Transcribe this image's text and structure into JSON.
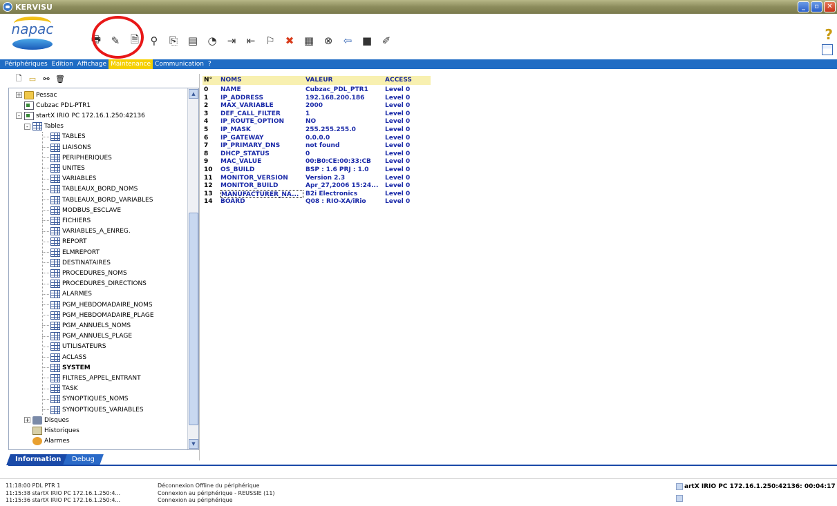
{
  "window": {
    "title": "KERVISU",
    "min_label": "_",
    "max_label": "▫",
    "close_label": "✕"
  },
  "logo": {
    "text": "napac"
  },
  "menu": {
    "items": [
      {
        "label": "Périphériques",
        "active": false
      },
      {
        "label": "Edition",
        "active": false
      },
      {
        "label": "Affichage",
        "active": false
      },
      {
        "label": "Maintenance",
        "active": true
      },
      {
        "label": "Communication",
        "active": false
      },
      {
        "label": "?",
        "active": false
      }
    ]
  },
  "toolbar": {
    "icons": [
      "print-icon",
      "edit-icon",
      "document-icon",
      "binoculars-icon",
      "copy-icon",
      "paste-icon",
      "disk-icon",
      "export-icon",
      "import-icon",
      "probe-icon",
      "cancel-icon",
      "properties-icon",
      "stop-icon",
      "back-icon",
      "black-panel-icon",
      "brush-icon"
    ],
    "help_label": "?"
  },
  "tree": {
    "rows": [
      {
        "label": "Pessac",
        "level": 1,
        "icon": "folder",
        "expander": "+"
      },
      {
        "label": "Cubzac PDL-PTR1",
        "level": 1,
        "icon": "device",
        "expander": ""
      },
      {
        "label": "startX IRIO PC 172.16.1.250:42136",
        "level": 1,
        "icon": "device",
        "expander": "-"
      },
      {
        "label": "Tables",
        "level": 2,
        "icon": "table",
        "expander": "-"
      },
      {
        "label": "TABLES",
        "level": 3,
        "icon": "table",
        "expander": ""
      },
      {
        "label": "LIAISONS",
        "level": 3,
        "icon": "table",
        "expander": ""
      },
      {
        "label": "PERIPHERIQUES",
        "level": 3,
        "icon": "table",
        "expander": ""
      },
      {
        "label": "UNITES",
        "level": 3,
        "icon": "table",
        "expander": ""
      },
      {
        "label": "VARIABLES",
        "level": 3,
        "icon": "table",
        "expander": ""
      },
      {
        "label": "TABLEAUX_BORD_NOMS",
        "level": 3,
        "icon": "table",
        "expander": ""
      },
      {
        "label": "TABLEAUX_BORD_VARIABLES",
        "level": 3,
        "icon": "table",
        "expander": ""
      },
      {
        "label": "MODBUS_ESCLAVE",
        "level": 3,
        "icon": "table",
        "expander": ""
      },
      {
        "label": "FICHIERS",
        "level": 3,
        "icon": "table",
        "expander": ""
      },
      {
        "label": "VARIABLES_A_ENREG.",
        "level": 3,
        "icon": "table",
        "expander": ""
      },
      {
        "label": "REPORT",
        "level": 3,
        "icon": "table",
        "expander": ""
      },
      {
        "label": "ELMREPORT",
        "level": 3,
        "icon": "table",
        "expander": ""
      },
      {
        "label": "DESTINATAIRES",
        "level": 3,
        "icon": "table",
        "expander": ""
      },
      {
        "label": "PROCEDURES_NOMS",
        "level": 3,
        "icon": "table",
        "expander": ""
      },
      {
        "label": "PROCEDURES_DIRECTIONS",
        "level": 3,
        "icon": "table",
        "expander": ""
      },
      {
        "label": "ALARMES",
        "level": 3,
        "icon": "table",
        "expander": ""
      },
      {
        "label": "PGM_HEBDOMADAIRE_NOMS",
        "level": 3,
        "icon": "table",
        "expander": ""
      },
      {
        "label": "PGM_HEBDOMADAIRE_PLAGE",
        "level": 3,
        "icon": "table",
        "expander": ""
      },
      {
        "label": "PGM_ANNUELS_NOMS",
        "level": 3,
        "icon": "table",
        "expander": ""
      },
      {
        "label": "PGM_ANNUELS_PLAGE",
        "level": 3,
        "icon": "table",
        "expander": ""
      },
      {
        "label": "UTILISATEURS",
        "level": 3,
        "icon": "table",
        "expander": ""
      },
      {
        "label": "ACLASS",
        "level": 3,
        "icon": "table",
        "expander": ""
      },
      {
        "label": "SYSTEM",
        "level": 3,
        "icon": "table",
        "expander": "",
        "bold": true
      },
      {
        "label": "FILTRES_APPEL_ENTRANT",
        "level": 3,
        "icon": "table",
        "expander": ""
      },
      {
        "label": "TASK",
        "level": 3,
        "icon": "table",
        "expander": ""
      },
      {
        "label": "SYNOPTIQUES_NOMS",
        "level": 3,
        "icon": "table",
        "expander": ""
      },
      {
        "label": "SYNOPTIQUES_VARIABLES",
        "level": 3,
        "icon": "table",
        "expander": ""
      },
      {
        "label": "Disques",
        "level": 2,
        "icon": "disk",
        "expander": "+"
      },
      {
        "label": "Historiques",
        "level": 2,
        "icon": "histo",
        "expander": ""
      },
      {
        "label": "Alarmes",
        "level": 2,
        "icon": "alarm",
        "expander": ""
      }
    ]
  },
  "tabs": [
    {
      "label": "Information",
      "active": true
    },
    {
      "label": "Debug",
      "active": false
    }
  ],
  "grid": {
    "headers": {
      "no": "N°",
      "nom": "NOMS",
      "val": "VALEUR",
      "acc": "ACCESS"
    },
    "rows": [
      {
        "no": "0",
        "nom": "NAME",
        "val": "Cubzac_PDL_PTR1",
        "acc": "Level 0"
      },
      {
        "no": "1",
        "nom": "IP_ADDRESS",
        "val": "192.168.200.186",
        "acc": "Level 0"
      },
      {
        "no": "2",
        "nom": "MAX_VARIABLE",
        "val": "2000",
        "acc": "Level 0"
      },
      {
        "no": "3",
        "nom": "DEF_CALL_FILTER",
        "val": "1",
        "acc": "Level 0"
      },
      {
        "no": "4",
        "nom": "IP_ROUTE_OPTION",
        "val": "NO",
        "acc": "Level 0"
      },
      {
        "no": "5",
        "nom": "IP_MASK",
        "val": "255.255.255.0",
        "acc": "Level 0"
      },
      {
        "no": "6",
        "nom": "IP_GATEWAY",
        "val": "0.0.0.0",
        "acc": "Level 0"
      },
      {
        "no": "7",
        "nom": "IP_PRIMARY_DNS",
        "val": "not found",
        "acc": "Level 0"
      },
      {
        "no": "8",
        "nom": "DHCP_STATUS",
        "val": "0",
        "acc": "Level 0"
      },
      {
        "no": "9",
        "nom": "MAC_VALUE",
        "val": "00:B0:CE:00:33:CB",
        "acc": "Level 0"
      },
      {
        "no": "10",
        "nom": "OS_BUILD",
        "val": "BSP : 1.6 PRJ : 1.0",
        "acc": "Level 0"
      },
      {
        "no": "11",
        "nom": "MONITOR_VERSION",
        "val": "Version 2.3",
        "acc": "Level 0"
      },
      {
        "no": "12",
        "nom": "MONITOR_BUILD",
        "val": "Apr_27,2006 15:24...",
        "acc": "Level 0"
      },
      {
        "no": "13",
        "nom": "MANUFACTURER_NA...",
        "val": "B2i Electronics",
        "acc": "Level 0",
        "selected": true
      },
      {
        "no": "14",
        "nom": "BOARD",
        "val": "Q08 : RIO-XA/iRio",
        "acc": "Level 0"
      }
    ]
  },
  "log": [
    {
      "time": "11:18:00 PDL PTR 1",
      "msg": "Déconnexion Offline du périphérique"
    },
    {
      "time": "11:15:38 startX IRIO PC 172.16.1.250:4...",
      "msg": "Connexion au périphérique - REUSSIE (11)"
    },
    {
      "time": "11:15:36 startX IRIO PC 172.16.1.250:4...",
      "msg": "Connexion au périphérique"
    }
  ],
  "status": {
    "text": "artX IRIO PC 172.16.1.250:42136: 00:04:17"
  }
}
